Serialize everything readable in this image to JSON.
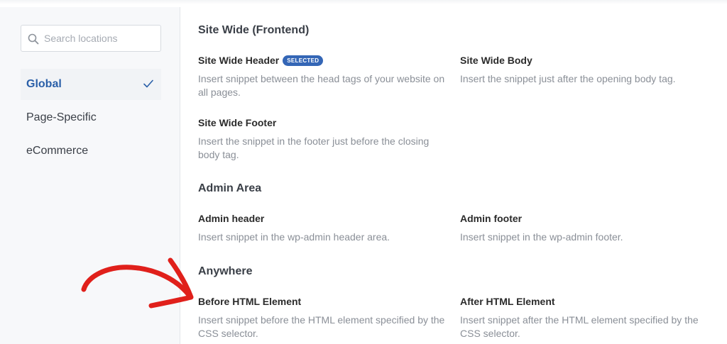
{
  "sidebar": {
    "search": {
      "placeholder": "Search locations",
      "value": ""
    },
    "items": [
      {
        "label": "Global",
        "active": true
      },
      {
        "label": "Page-Specific",
        "active": false
      },
      {
        "label": "eCommerce",
        "active": false
      }
    ]
  },
  "main": {
    "sections": [
      {
        "title": "Site Wide (Frontend)",
        "options": [
          {
            "title": "Site Wide Header",
            "badge": "SELECTED",
            "desc": "Insert snippet between the head tags of your website on all pages."
          },
          {
            "title": "Site Wide Body",
            "desc": "Insert the snippet just after the opening body tag."
          },
          {
            "title": "Site Wide Footer",
            "desc": "Insert the snippet in the footer just before the closing body tag."
          }
        ]
      },
      {
        "title": "Admin Area",
        "options": [
          {
            "title": "Admin header",
            "desc": "Insert snippet in the wp-admin header area."
          },
          {
            "title": "Admin footer",
            "desc": "Insert snippet in the wp-admin footer."
          }
        ]
      },
      {
        "title": "Anywhere",
        "options": [
          {
            "title": "Before HTML Element",
            "desc": "Insert snippet before the HTML element specified by the CSS selector."
          },
          {
            "title": "After HTML Element",
            "desc": "Insert snippet after the HTML element specified by the CSS selector."
          }
        ]
      }
    ]
  },
  "colors": {
    "accent": "#2a5fa8",
    "badge": "#3466b6",
    "annotation_arrow": "#e0201b"
  },
  "icons": [
    "search-icon",
    "check-icon",
    "annotation-arrow"
  ]
}
